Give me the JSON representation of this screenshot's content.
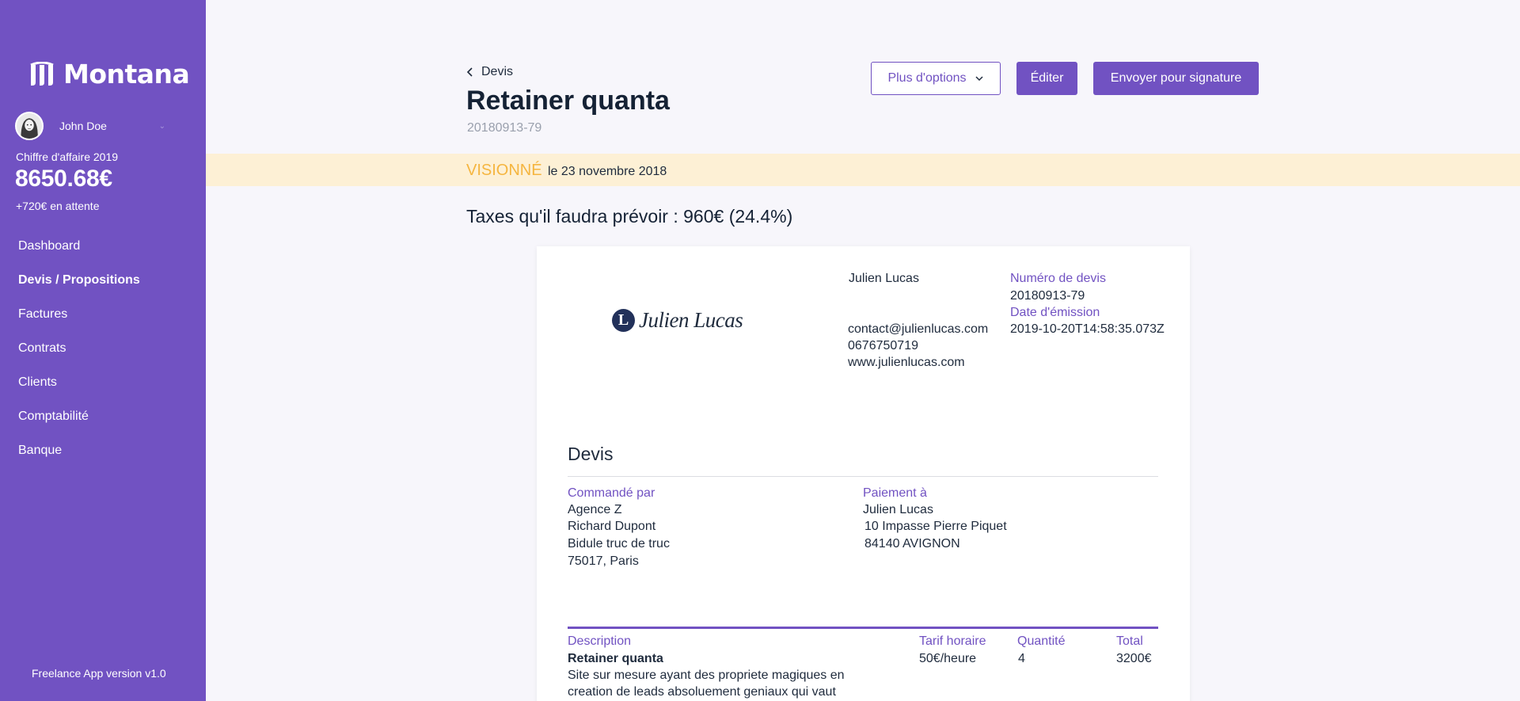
{
  "sidebar": {
    "logo_text": "Montana",
    "user_name": "John Doe",
    "revenue_label": "Chiffre d'affaire 2019",
    "revenue_value": "8650.68€",
    "revenue_pending": "+720€ en attente",
    "nav": [
      {
        "label": "Dashboard"
      },
      {
        "label": "Devis / Propositions",
        "active": true
      },
      {
        "label": "Factures"
      },
      {
        "label": "Contrats"
      },
      {
        "label": "Clients"
      },
      {
        "label": "Comptabilité"
      },
      {
        "label": "Banque"
      }
    ],
    "version": "Freelance App version v1.0"
  },
  "header": {
    "back_label": "Devis",
    "title": "Retainer quanta",
    "subtitle": "20180913-79",
    "more_options": "Plus d'options",
    "edit": "Éditer",
    "send": "Envoyer pour signature"
  },
  "banner": {
    "status": "VISIONNÉ",
    "date": "le 23 novembre 2018"
  },
  "taxes": "Taxes qu'il faudra prévoir : 960€ (24.4%)",
  "document": {
    "logo_letter": "L",
    "logo_name": "Julien Lucas",
    "sender": {
      "name": "Julien Lucas",
      "email": "contact@julienlucas.com",
      "phone": "0676750719",
      "website": "www.julienlucas.com"
    },
    "quote_number_label": "Numéro de devis",
    "quote_number": "20180913-79",
    "issue_date_label": "Date d'émission",
    "issue_date": "2019-10-20T14:58:35.073Z",
    "heading": "Devis",
    "ordered_by_label": "Commandé par",
    "ordered_by": [
      "Agence Z",
      "Richard Dupont",
      "Bidule truc de truc",
      "75017, Paris"
    ],
    "payment_to_label": "Paiement à",
    "payment_to": [
      "Julien Lucas",
      "10 Impasse Pierre Piquet",
      "84140 AVIGNON"
    ],
    "table": {
      "headers": {
        "description": "Description",
        "rate": "Tarif horaire",
        "quantity": "Quantité",
        "total": "Total"
      },
      "rows": [
        {
          "title": "Retainer quanta",
          "description_line1": "Site sur mesure ayant des propriete magiques en",
          "description_line2": "creation de leads absoluement geniaux qui vaut",
          "rate": "50€/heure",
          "quantity": "4",
          "total": "3200€"
        }
      ]
    }
  }
}
